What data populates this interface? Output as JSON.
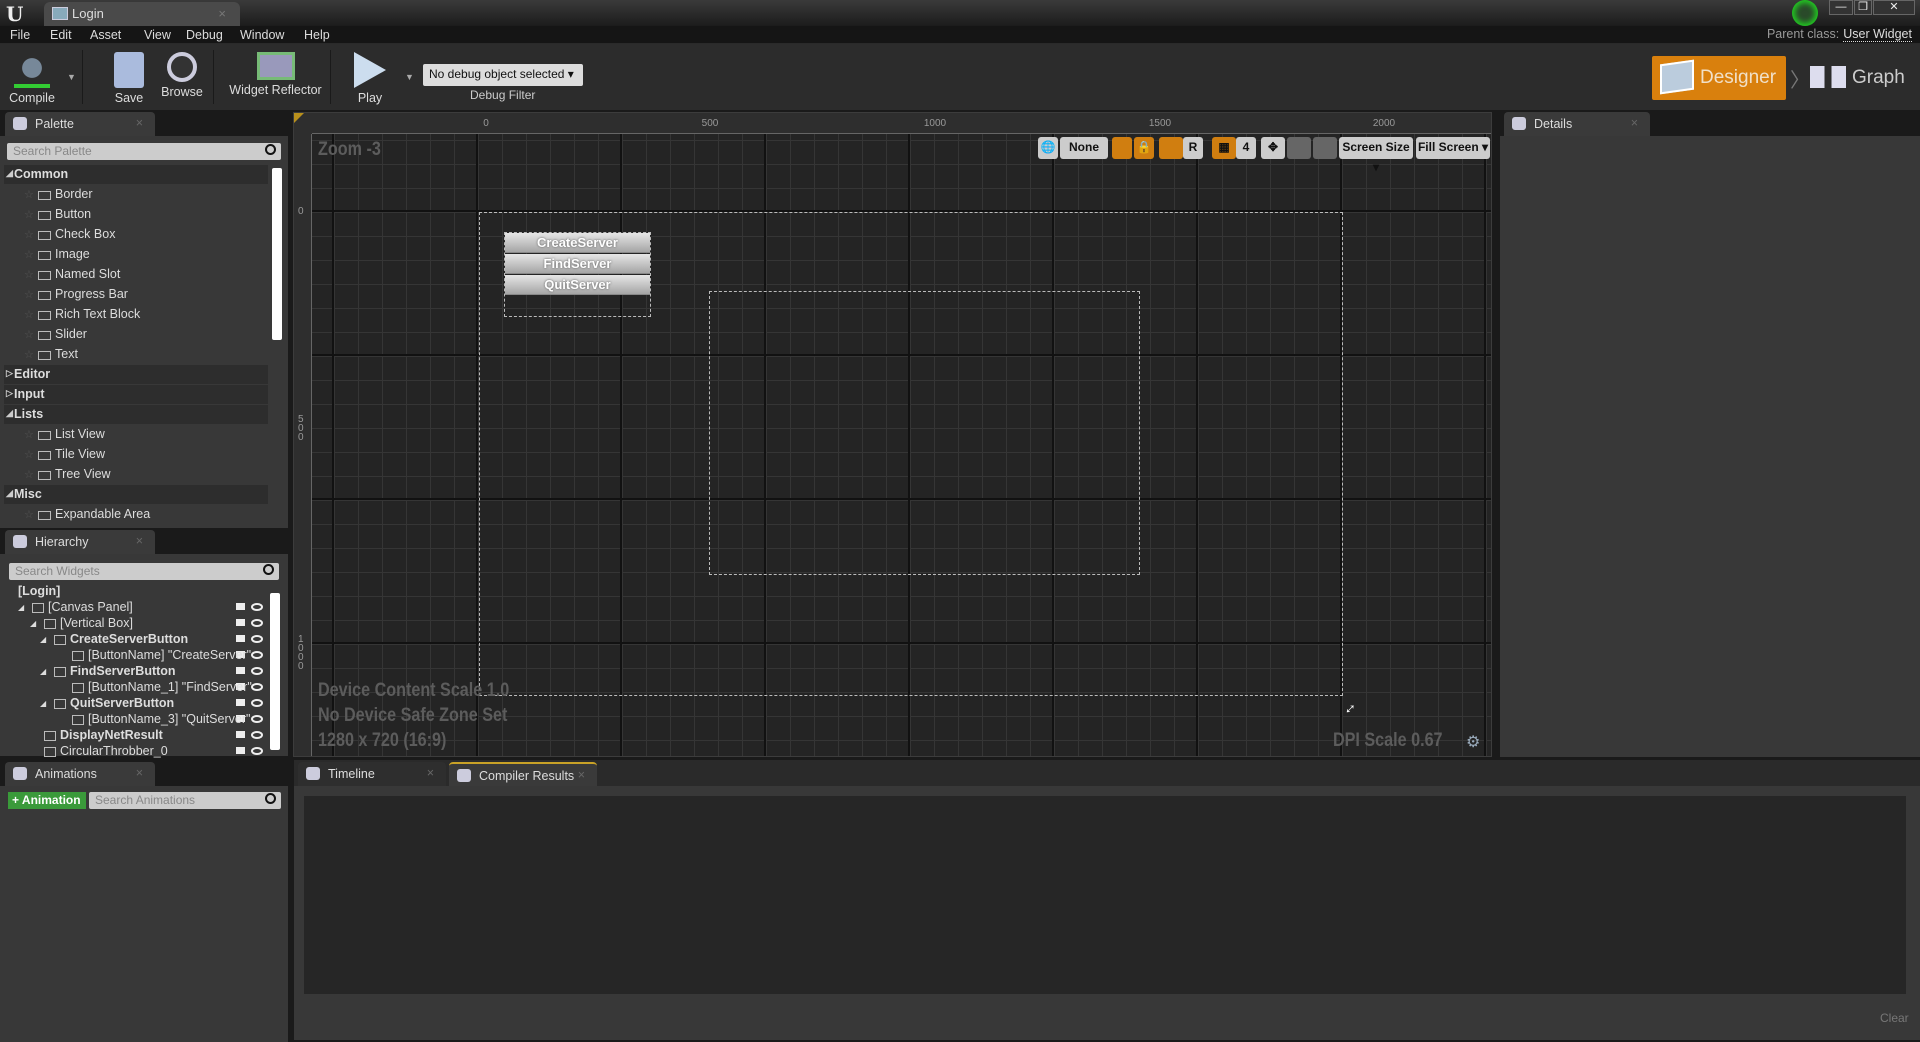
{
  "window": {
    "tab_title": "Login",
    "min": "—",
    "restore": "❐",
    "close": "✕"
  },
  "menu": [
    "File",
    "Edit",
    "Asset",
    "View",
    "Debug",
    "Window",
    "Help"
  ],
  "parent_class": {
    "label": "Parent class:",
    "value": "User Widget"
  },
  "toolbar": {
    "compile": "Compile",
    "save": "Save",
    "browse": "Browse",
    "widget_reflector": "Widget Reflector",
    "play": "Play",
    "debug_filter_value": "No debug object selected ▾",
    "debug_filter_label": "Debug Filter"
  },
  "mode": {
    "designer": "Designer",
    "graph": "Graph",
    "active": "Designer",
    "accent": "#d9800d"
  },
  "palette": {
    "title": "Palette",
    "search_placeholder": "Search Palette",
    "categories": [
      {
        "name": "Common",
        "expanded": true,
        "items": [
          "Border",
          "Button",
          "Check Box",
          "Image",
          "Named Slot",
          "Progress Bar",
          "Rich Text Block",
          "Slider",
          "Text"
        ]
      },
      {
        "name": "Editor",
        "expanded": false,
        "items": []
      },
      {
        "name": "Input",
        "expanded": false,
        "items": []
      },
      {
        "name": "Lists",
        "expanded": true,
        "items": [
          "List View",
          "Tile View",
          "Tree View"
        ]
      },
      {
        "name": "Misc",
        "expanded": true,
        "items": [
          "Expandable Area"
        ]
      }
    ]
  },
  "hierarchy": {
    "title": "Hierarchy",
    "search_placeholder": "Search Widgets",
    "rows": [
      {
        "label": "[Login]",
        "depth": 0,
        "bold": true
      },
      {
        "label": "[Canvas Panel]",
        "depth": 1,
        "bold": false
      },
      {
        "label": "[Vertical Box]",
        "depth": 2,
        "bold": false
      },
      {
        "label": "CreateServerButton",
        "depth": 3,
        "bold": true
      },
      {
        "label": "[ButtonName] \"CreateServer\"",
        "depth": 4,
        "bold": false
      },
      {
        "label": "FindServerButton",
        "depth": 3,
        "bold": true
      },
      {
        "label": "[ButtonName_1] \"FindServer\"",
        "depth": 4,
        "bold": false
      },
      {
        "label": "QuitServerButton",
        "depth": 3,
        "bold": true
      },
      {
        "label": "[ButtonName_3] \"QuitServer\"",
        "depth": 4,
        "bold": false
      },
      {
        "label": "DisplayNetResult",
        "depth": 2,
        "bold": true
      },
      {
        "label": "CircularThrobber_0",
        "depth": 2,
        "bold": false
      }
    ]
  },
  "animations": {
    "title": "Animations",
    "add_label": "+ Animation",
    "search_placeholder": "Search Animations"
  },
  "designer": {
    "zoom": "Zoom -3",
    "ruler_h": [
      "0",
      "500",
      "1000",
      "1500",
      "2000"
    ],
    "ruler_v": [
      "0",
      "500",
      "1000"
    ],
    "buttons": [
      "CreateServer",
      "FindServer",
      "QuitServer"
    ],
    "toolbar": {
      "none": "None",
      "r": "R",
      "grid": "4",
      "screen_size": "Screen Size ▾",
      "fill_screen": "Fill Screen ▾"
    },
    "info": [
      "Device Content Scale 1.0",
      "No Device Safe Zone Set",
      "1280 x 720 (16:9)"
    ],
    "dpi": "DPI Scale 0.67"
  },
  "details": {
    "title": "Details"
  },
  "bottom": {
    "tabs": [
      "Timeline",
      "Compiler Results"
    ],
    "active": "Compiler Results",
    "clear": "Clear"
  }
}
